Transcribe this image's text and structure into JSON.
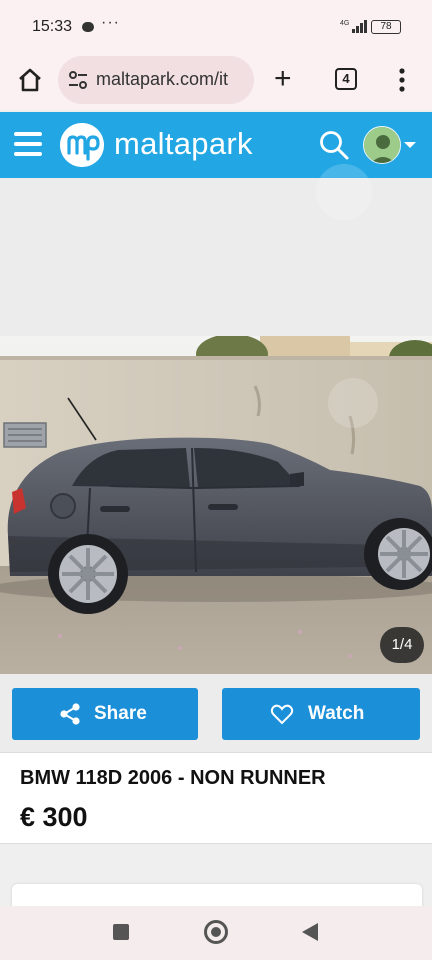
{
  "status_bar": {
    "time": "15:33",
    "dots": "···",
    "battery": "78"
  },
  "browser": {
    "url": "maltapark.com/it",
    "tab_count": "4"
  },
  "site": {
    "logo_text": "maltapark",
    "brand_color": "#22a7e4"
  },
  "listing": {
    "photo_counter": "1/4",
    "title": "BMW 118D 2006 - NON RUNNER",
    "price": "€ 300"
  },
  "actions": {
    "share_label": "Share",
    "watch_label": "Watch",
    "button_color": "#1b8fd8"
  },
  "icons": {
    "home": "home-icon",
    "site_settings": "tune-icon",
    "new_tab": "plus-icon",
    "tabs": "tab-count-icon",
    "overflow": "more-vert-icon",
    "menu": "hamburger-icon",
    "search": "search-icon",
    "share": "share-icon",
    "watch": "heart-icon"
  }
}
